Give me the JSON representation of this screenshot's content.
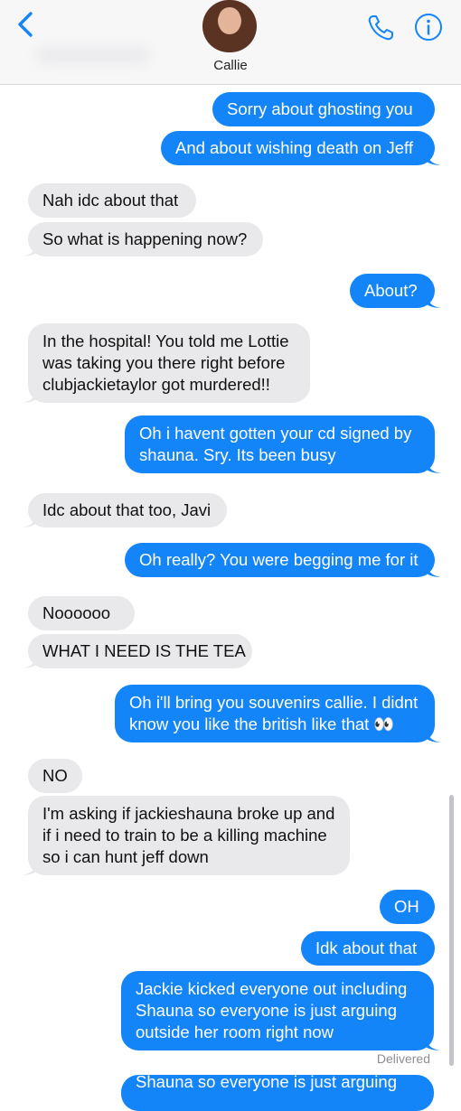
{
  "header": {
    "contact_name": "Callie",
    "icons": [
      "chevron-left-icon",
      "avatar",
      "phone-icon",
      "info-icon"
    ],
    "accent_color": "#1485f8"
  },
  "messages": [
    {
      "dir": "out",
      "text": "Sorry about ghosting you"
    },
    {
      "dir": "out",
      "text": "And about wishing death on Jeff"
    },
    {
      "dir": "in",
      "text": "Nah idc about that"
    },
    {
      "dir": "in",
      "text": "So what is happening now?"
    },
    {
      "dir": "out",
      "text": "About?"
    },
    {
      "dir": "in",
      "lines": [
        "In the hospital! You told me Lottie",
        "was taking you there right before",
        "clubjackietaylor got murdered!!"
      ]
    },
    {
      "dir": "out",
      "lines": [
        "Oh i havent gotten your cd signed by",
        "shauna. Sry. Its been busy"
      ]
    },
    {
      "dir": "in",
      "text": "Idc about that too, Javi"
    },
    {
      "dir": "out",
      "text": "Oh really? You were begging me for it"
    },
    {
      "dir": "in",
      "text": "Noooooo"
    },
    {
      "dir": "in",
      "text": "WHAT I NEED IS THE TEA"
    },
    {
      "dir": "out",
      "lines": [
        "Oh i'll bring you souvenirs callie. I didnt",
        "know you like the british like that 👀"
      ]
    },
    {
      "dir": "in",
      "text": "NO"
    },
    {
      "dir": "in",
      "lines": [
        "I'm asking if jackieshauna broke up and",
        "if i need to train to be a killing machine",
        "so i can hunt jeff down"
      ]
    },
    {
      "dir": "out",
      "text": "OH"
    },
    {
      "dir": "out",
      "text": "Idk about that"
    },
    {
      "dir": "out",
      "lines": [
        "Jackie kicked everyone out  including",
        "Shauna so everyone is just arguing",
        "outside her room right now"
      ]
    }
  ],
  "status": {
    "delivered": "Delivered"
  },
  "partial_next": "Shauna so everyone is just arguing"
}
